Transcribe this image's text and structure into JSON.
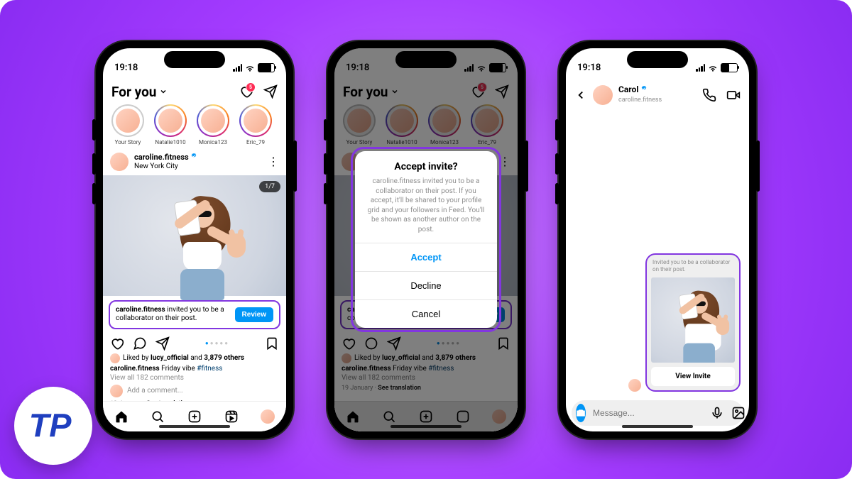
{
  "status": {
    "time": "19:18"
  },
  "feed": {
    "tab": "For you",
    "notif_badge": "5",
    "stories": [
      "Your Story",
      "Natalie1010",
      "Monica123",
      "Eric_79"
    ],
    "post": {
      "username": "caroline.fitness",
      "location": "New York City",
      "counter": "1/7",
      "invite_text_1": "caroline.fitness",
      "invite_text_2": " invited you to be a collaborator on their post.",
      "review": "Review",
      "liked_by_prefix": "Liked by ",
      "liked_by_user": "lucy_official",
      "liked_by_mid": " and ",
      "liked_by_count": "3,879 others",
      "caption_user": "caroline.fitness",
      "caption_text": " Friday vibe ",
      "caption_hash": "#fitness",
      "view_comments": "View all 182 comments",
      "add_comment": "Add a comment...",
      "date": "19 January",
      "see_trans": "See translation"
    }
  },
  "dialog": {
    "title": "Accept invite?",
    "body": "caroline.fitness invited you to be a collaborator on their post. If you accept, it'll be shared to your profile grid and your followers in Feed. You'll be shown as another author on the post.",
    "accept": "Accept",
    "decline": "Decline",
    "cancel": "Cancel"
  },
  "dm": {
    "name": "Carol",
    "handle": "caroline.fitness",
    "card_text": "Invited you to be a collaborator on their post.",
    "view_invite": "View Invite",
    "placeholder": "Message..."
  },
  "logo_text": "TP"
}
